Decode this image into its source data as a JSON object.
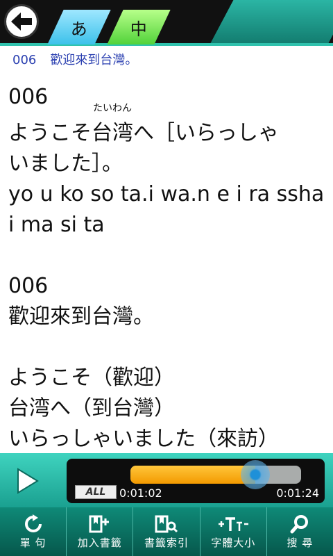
{
  "top_bar": {
    "tab_japanese": "あ",
    "tab_chinese": "中"
  },
  "subheader": {
    "number": "006",
    "text": "歡迎來到台灣。"
  },
  "content": {
    "num_1": "006",
    "line_1a_pre": "ようこそ",
    "ruby_base": "台湾",
    "ruby_text": "たいわん",
    "line_1a_post": "へ［いらっしゃ",
    "line_1b": "いました］。",
    "romaji_1": "yo u ko so ta.i wa.n e i ra ssha",
    "romaji_2": "i ma si ta",
    "num_2": "006",
    "chinese_line": "歡迎來到台灣。",
    "vocab": [
      "ようこそ（歡迎）",
      "台湾へ（到台灣）",
      "いらっしゃいました（來訪）"
    ]
  },
  "player": {
    "all_label": "ALL",
    "current_time": "0:01:02",
    "total_time": "0:01:24",
    "progress": 0.73
  },
  "toolbar": {
    "items": [
      {
        "label": "單 句",
        "icon": "refresh-icon"
      },
      {
        "label": "加入書籤",
        "icon": "bookmark-add-icon"
      },
      {
        "label": "書籤索引",
        "icon": "bookmark-search-icon"
      },
      {
        "label": "字體大小",
        "icon": "font-size-icon"
      },
      {
        "label": "搜 尋",
        "icon": "search-icon"
      }
    ]
  }
}
